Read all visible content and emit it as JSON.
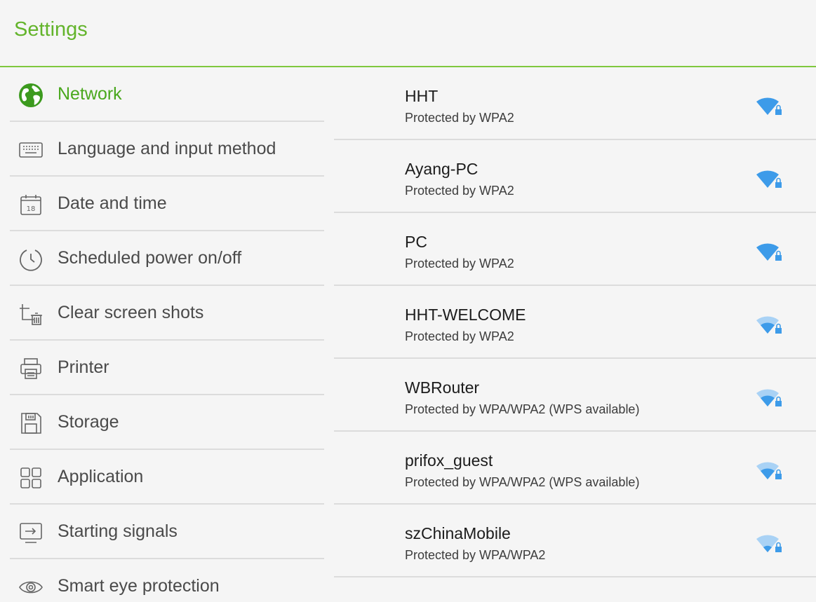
{
  "header": {
    "title": "Settings"
  },
  "sidebar": {
    "items": [
      {
        "label": "Network",
        "icon": "globe-icon",
        "active": true
      },
      {
        "label": "Language and input method",
        "icon": "keyboard-icon",
        "active": false
      },
      {
        "label": "Date and time",
        "icon": "calendar-icon",
        "active": false
      },
      {
        "label": "Scheduled power on/off",
        "icon": "timer-icon",
        "active": false
      },
      {
        "label": "Clear screen shots",
        "icon": "crop-trash-icon",
        "active": false
      },
      {
        "label": "Printer",
        "icon": "printer-icon",
        "active": false
      },
      {
        "label": "Storage",
        "icon": "storage-icon",
        "active": false
      },
      {
        "label": "Application",
        "icon": "apps-grid-icon",
        "active": false
      },
      {
        "label": "Starting signals",
        "icon": "input-signal-icon",
        "active": false
      },
      {
        "label": "Smart eye protection",
        "icon": "eye-icon",
        "active": false
      }
    ]
  },
  "wifi": {
    "networks": [
      {
        "name": "HHT",
        "security": "Protected by WPA2",
        "signal_icon": "wifi-lock-icon",
        "strength": "strong"
      },
      {
        "name": "Ayang-PC",
        "security": "Protected by WPA2",
        "signal_icon": "wifi-lock-icon",
        "strength": "strong"
      },
      {
        "name": "PC",
        "security": "Protected by WPA2",
        "signal_icon": "wifi-lock-icon",
        "strength": "strong"
      },
      {
        "name": "HHT-WELCOME",
        "security": "Protected by WPA2",
        "signal_icon": "wifi-lock-icon",
        "strength": "medium"
      },
      {
        "name": "WBRouter",
        "security": "Protected by WPA/WPA2  (WPS available)",
        "signal_icon": "wifi-lock-icon",
        "strength": "medium"
      },
      {
        "name": "prifox_guest",
        "security": "Protected by WPA/WPA2  (WPS available)",
        "signal_icon": "wifi-lock-icon",
        "strength": "medium"
      },
      {
        "name": "szChinaMobile",
        "security": "Protected by WPA/WPA2",
        "signal_icon": "wifi-lock-icon",
        "strength": "weak"
      }
    ]
  },
  "colors": {
    "accent": "#63b42b",
    "divider": "#dcdcdc",
    "wifi_strong": "#3d9be9",
    "wifi_faded": "#a9d2f5"
  }
}
